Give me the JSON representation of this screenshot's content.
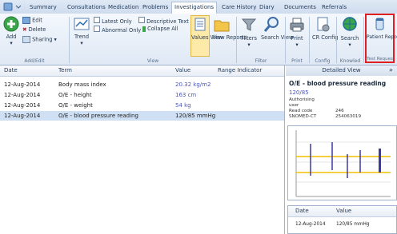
{
  "tabs": [
    "Summary",
    "Consultations",
    "Medication",
    "Problems",
    "Investigations",
    "Care History",
    "Diary",
    "Documents",
    "Referrals"
  ],
  "active_tab": "Investigations",
  "ribbon": {
    "add": "Add",
    "edit": "Edit",
    "delete": "Delete",
    "sharing": "Sharing",
    "trend": "Trend",
    "latest_only": "Latest Only",
    "abnormal_only": "Abnormal Only",
    "descriptive_text": "Descriptive Text",
    "collapse_all": "Collapse All",
    "values_view": "Values View",
    "view_reports": "View Reports",
    "filters": "Filters",
    "search_view": "Search View",
    "print": "Print",
    "cr_config": "CR Config",
    "search": "Search",
    "patient_report_list": "Patient Report List",
    "groups": {
      "add_edit": "Add/Edit",
      "view": "View",
      "filter": "Filter",
      "print": "Print",
      "config": "Config",
      "knowled": "Knowled",
      "test_reques": "Test Reques"
    }
  },
  "table": {
    "headers": [
      "Date",
      "Term",
      "Value",
      "Range Indicator"
    ],
    "rows": [
      {
        "date": "12-Aug-2014",
        "term": "Body mass index",
        "value": "20.32 kg/m2"
      },
      {
        "date": "12-Aug-2014",
        "term": "O/E - height",
        "value": "163 cm"
      },
      {
        "date": "12-Aug-2014",
        "term": "O/E - weight",
        "value": "54 kg"
      },
      {
        "date": "12-Aug-2014",
        "term": "O/E - blood pressure reading",
        "value": "120/85 mmHg"
      }
    ]
  },
  "detail": {
    "header": "Detailed View",
    "collapse": "»",
    "title": "O/E - blood pressure reading",
    "value": "120/85",
    "authorising": "Authorising",
    "user": "user",
    "read_code_label": "Read code",
    "read_code": "246",
    "snomed_label": "SNOMED-CT",
    "snomed": "254063019",
    "table_headers": [
      "Date",
      "Value"
    ],
    "table_row": {
      "date": "12-Aug-2014",
      "value": "120/85 mmHg"
    }
  },
  "colors": {
    "accent": "#2f6db5",
    "selected_row": "#cfe0f4",
    "highlight_border": "#e02020",
    "bar": "#3a3aa0",
    "line": "#f0c000"
  }
}
